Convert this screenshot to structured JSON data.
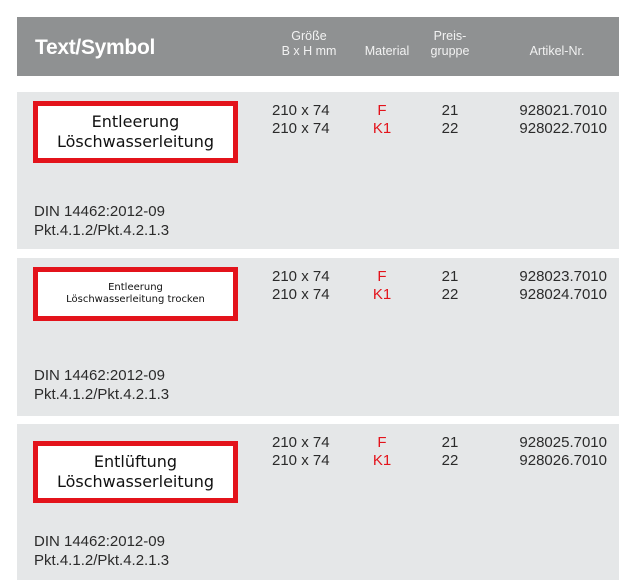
{
  "header": {
    "title": "Text/Symbol",
    "size_line1": "Größe",
    "size_line2": "B x H mm",
    "material": "Material",
    "price_line1": "Preis-",
    "price_line2": "gruppe",
    "article": "Artikel-Nr."
  },
  "colors": {
    "header_bg": "#8f9192",
    "row_bg": "#e5e7e8",
    "sign_red": "#e3131b"
  },
  "rows": [
    {
      "sign_line1": "Entleerung",
      "sign_line2": "Löschwasserleitung",
      "variants": [
        {
          "size": "210 x 74",
          "material": "F",
          "price": "21",
          "article": "928021.7010"
        },
        {
          "size": "210 x 74",
          "material": "K1",
          "price": "22",
          "article": "928022.7010"
        }
      ],
      "norm_line1": "DIN 14462:2012-09",
      "norm_line2": "Pkt.4.1.2/Pkt.4.2.1.3"
    },
    {
      "sign_line1": "Entleerung",
      "sign_line2": "Löschwasserleitung trocken",
      "variants": [
        {
          "size": "210 x 74",
          "material": "F",
          "price": "21",
          "article": "928023.7010"
        },
        {
          "size": "210 x 74",
          "material": "K1",
          "price": "22",
          "article": "928024.7010"
        }
      ],
      "norm_line1": "DIN 14462:2012-09",
      "norm_line2": "Pkt.4.1.2/Pkt.4.2.1.3"
    },
    {
      "sign_line1": "Entlüftung",
      "sign_line2": "Löschwasserleitung",
      "variants": [
        {
          "size": "210 x 74",
          "material": "F",
          "price": "21",
          "article": "928025.7010"
        },
        {
          "size": "210 x 74",
          "material": "K1",
          "price": "22",
          "article": "928026.7010"
        }
      ],
      "norm_line1": "DIN 14462:2012-09",
      "norm_line2": "Pkt.4.1.2/Pkt.4.2.1.3"
    }
  ]
}
